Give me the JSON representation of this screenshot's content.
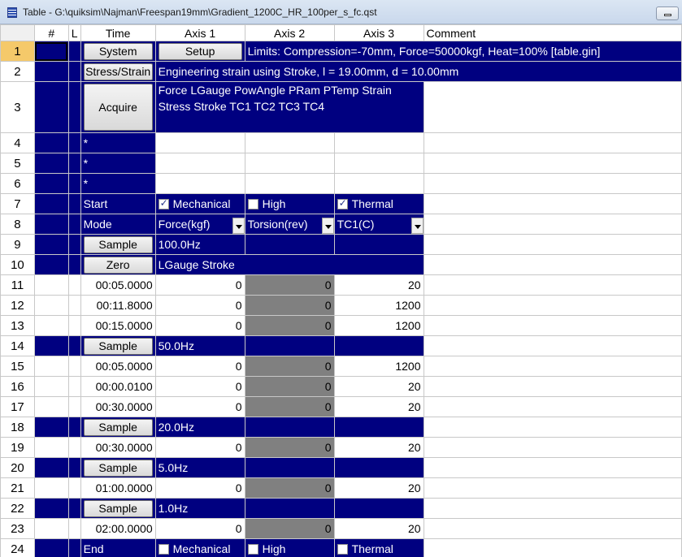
{
  "window": {
    "title": "Table - G:\\quiksim\\Najman\\Freespan19mm\\Gradient_1200C_HR_100per_s_fc.qst"
  },
  "columns": [
    "#",
    "L",
    "Time",
    "Axis 1",
    "Axis 2",
    "Axis 3",
    "Comment"
  ],
  "rows": {
    "r1": {
      "num": "1",
      "system": "System",
      "setup": "Setup",
      "limits": "Limits: Compression=-70mm, Force=50000kgf, Heat=100% [table.gin]"
    },
    "r2": {
      "num": "2",
      "stress_strain": "Stress/Strain",
      "desc": "Engineering strain using Stroke, l = 19.00mm, d = 10.00mm"
    },
    "r3": {
      "num": "3",
      "acquire": "Acquire",
      "line1": "Force LGauge PowAngle PRam PTemp Strain",
      "line2": "Stress Stroke TC1 TC2 TC3 TC4"
    },
    "r4": {
      "num": "4",
      "mark": "*"
    },
    "r5": {
      "num": "5",
      "mark": "*"
    },
    "r6": {
      "num": "6",
      "mark": "*"
    },
    "r7": {
      "num": "7",
      "label": "Start",
      "a1": "Mechanical",
      "a2": "High",
      "a3": "Thermal"
    },
    "r8": {
      "num": "8",
      "label": "Mode",
      "a1": "Force(kgf)",
      "a2": "Torsion(rev)",
      "a3": "TC1(C)"
    },
    "r9": {
      "num": "9",
      "btn": "Sample",
      "text": "100.0Hz"
    },
    "r10": {
      "num": "10",
      "btn": "Zero",
      "text": "LGauge Stroke"
    },
    "r11": {
      "num": "11",
      "time": "00:05.0000",
      "a1": "0",
      "a2": "0",
      "a3": "20"
    },
    "r12": {
      "num": "12",
      "time": "00:11.8000",
      "a1": "0",
      "a2": "0",
      "a3": "1200"
    },
    "r13": {
      "num": "13",
      "time": "00:15.0000",
      "a1": "0",
      "a2": "0",
      "a3": "1200"
    },
    "r14": {
      "num": "14",
      "btn": "Sample",
      "text": "50.0Hz"
    },
    "r15": {
      "num": "15",
      "time": "00:05.0000",
      "a1": "0",
      "a2": "0",
      "a3": "1200"
    },
    "r16": {
      "num": "16",
      "time": "00:00.0100",
      "a1": "0",
      "a2": "0",
      "a3": "20"
    },
    "r17": {
      "num": "17",
      "time": "00:30.0000",
      "a1": "0",
      "a2": "0",
      "a3": "20"
    },
    "r18": {
      "num": "18",
      "btn": "Sample",
      "text": "20.0Hz"
    },
    "r19": {
      "num": "19",
      "time": "00:30.0000",
      "a1": "0",
      "a2": "0",
      "a3": "20"
    },
    "r20": {
      "num": "20",
      "btn": "Sample",
      "text": "5.0Hz"
    },
    "r21": {
      "num": "21",
      "time": "01:00.0000",
      "a1": "0",
      "a2": "0",
      "a3": "20"
    },
    "r22": {
      "num": "22",
      "btn": "Sample",
      "text": "1.0Hz"
    },
    "r23": {
      "num": "23",
      "time": "02:00.0000",
      "a1": "0",
      "a2": "0",
      "a3": "20"
    },
    "r24": {
      "num": "24",
      "label": "End",
      "a1": "Mechanical",
      "a2": "High",
      "a3": "Thermal"
    }
  },
  "checkboxes": {
    "start_mechanical": true,
    "start_high": false,
    "start_thermal": true,
    "end_mechanical": false,
    "end_high": false,
    "end_thermal": false
  },
  "icons": {
    "app": "table-icon",
    "restore": "restore-icon",
    "dropdown": "chevron-down-icon"
  },
  "colors": {
    "row_fill": "#000080",
    "disabled_axis": "#808080",
    "selected_row_header": "#f5c96a"
  }
}
